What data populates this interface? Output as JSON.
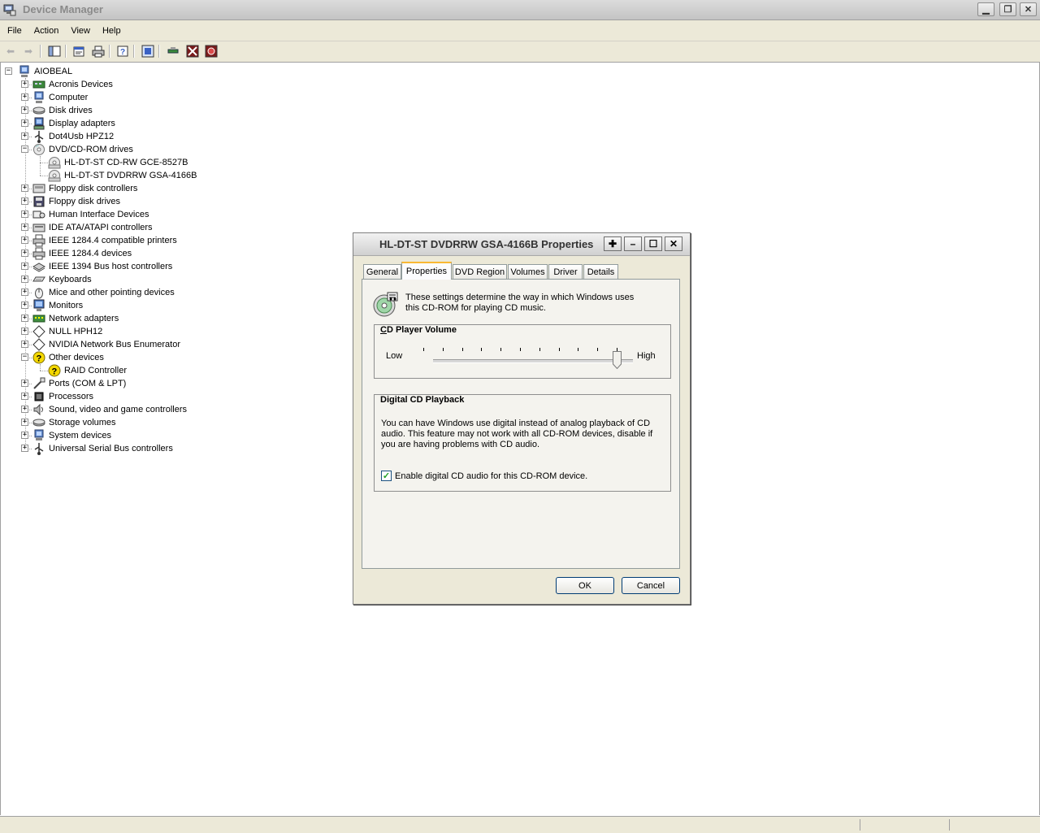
{
  "window": {
    "title": "Device Manager"
  },
  "menu": [
    "File",
    "Action",
    "View",
    "Help"
  ],
  "tree": {
    "root": "AIOBEAL",
    "categories": [
      {
        "label": "Acronis Devices",
        "icon": "acronis-device-icon",
        "expanded": false
      },
      {
        "label": "Computer",
        "icon": "computer-icon",
        "expanded": false
      },
      {
        "label": "Disk drives",
        "icon": "disk-drive-icon",
        "expanded": false
      },
      {
        "label": "Display adapters",
        "icon": "display-adapter-icon",
        "expanded": false
      },
      {
        "label": "Dot4Usb HPZ12",
        "icon": "usb-icon",
        "expanded": false
      },
      {
        "label": "DVD/CD-ROM drives",
        "icon": "cdrom-icon",
        "expanded": true,
        "children": [
          "HL-DT-ST CD-RW GCE-8527B",
          "HL-DT-ST DVDRRW GSA-4166B"
        ]
      },
      {
        "label": "Floppy disk controllers",
        "icon": "floppy-controller-icon",
        "expanded": false
      },
      {
        "label": "Floppy disk drives",
        "icon": "floppy-drive-icon",
        "expanded": false
      },
      {
        "label": "Human Interface Devices",
        "icon": "hid-icon",
        "expanded": false
      },
      {
        "label": "IDE ATA/ATAPI controllers",
        "icon": "ide-controller-icon",
        "expanded": false
      },
      {
        "label": "IEEE 1284.4 compatible printers",
        "icon": "printer-icon",
        "expanded": false
      },
      {
        "label": "IEEE 1284.4 devices",
        "icon": "printer-icon",
        "expanded": false
      },
      {
        "label": "IEEE 1394 Bus host controllers",
        "icon": "firewire-icon",
        "expanded": false
      },
      {
        "label": "Keyboards",
        "icon": "keyboard-icon",
        "expanded": false
      },
      {
        "label": "Mice and other pointing devices",
        "icon": "mouse-icon",
        "expanded": false
      },
      {
        "label": "Monitors",
        "icon": "monitor-icon",
        "expanded": false
      },
      {
        "label": "Network adapters",
        "icon": "network-adapter-icon",
        "expanded": false
      },
      {
        "label": "NULL HPH12",
        "icon": "generic-device-icon",
        "expanded": false
      },
      {
        "label": "NVIDIA Network Bus Enumerator",
        "icon": "generic-device-icon",
        "expanded": false
      },
      {
        "label": "Other devices",
        "icon": "unknown-device-icon",
        "expanded": true,
        "children": [
          "RAID Controller"
        ]
      },
      {
        "label": "Ports (COM & LPT)",
        "icon": "port-icon",
        "expanded": false
      },
      {
        "label": "Processors",
        "icon": "processor-icon",
        "expanded": false
      },
      {
        "label": "Sound, video and game controllers",
        "icon": "sound-icon",
        "expanded": false
      },
      {
        "label": "Storage volumes",
        "icon": "storage-volume-icon",
        "expanded": false
      },
      {
        "label": "System devices",
        "icon": "system-device-icon",
        "expanded": false
      },
      {
        "label": "Universal Serial Bus controllers",
        "icon": "usb-icon",
        "expanded": false
      }
    ]
  },
  "dialog": {
    "title": "HL-DT-ST DVDRRW GSA-4166B Properties",
    "tabs": [
      "General",
      "Properties",
      "DVD Region",
      "Volumes",
      "Driver",
      "Details"
    ],
    "active_tab": "Properties",
    "intro": "These settings determine the way in which Windows uses this CD-ROM for playing CD music.",
    "volume": {
      "title": "CD Player Volume",
      "low": "Low",
      "high": "High",
      "level": 1.0,
      "ticks": 11
    },
    "digital": {
      "title": "Digital CD Playback",
      "description": "You can have Windows use digital instead of analog playback of CD audio.  This feature may not work with all CD-ROM devices, disable if you are having problems with CD audio.",
      "checkbox_label": "Enable digital CD audio for this CD-ROM device.",
      "checked": true
    },
    "buttons": {
      "ok": "OK",
      "cancel": "Cancel"
    }
  },
  "colors": {
    "tab_highlight": "#f9b834",
    "checkmark": "#21a121",
    "unknown_device": "#f4d800"
  }
}
